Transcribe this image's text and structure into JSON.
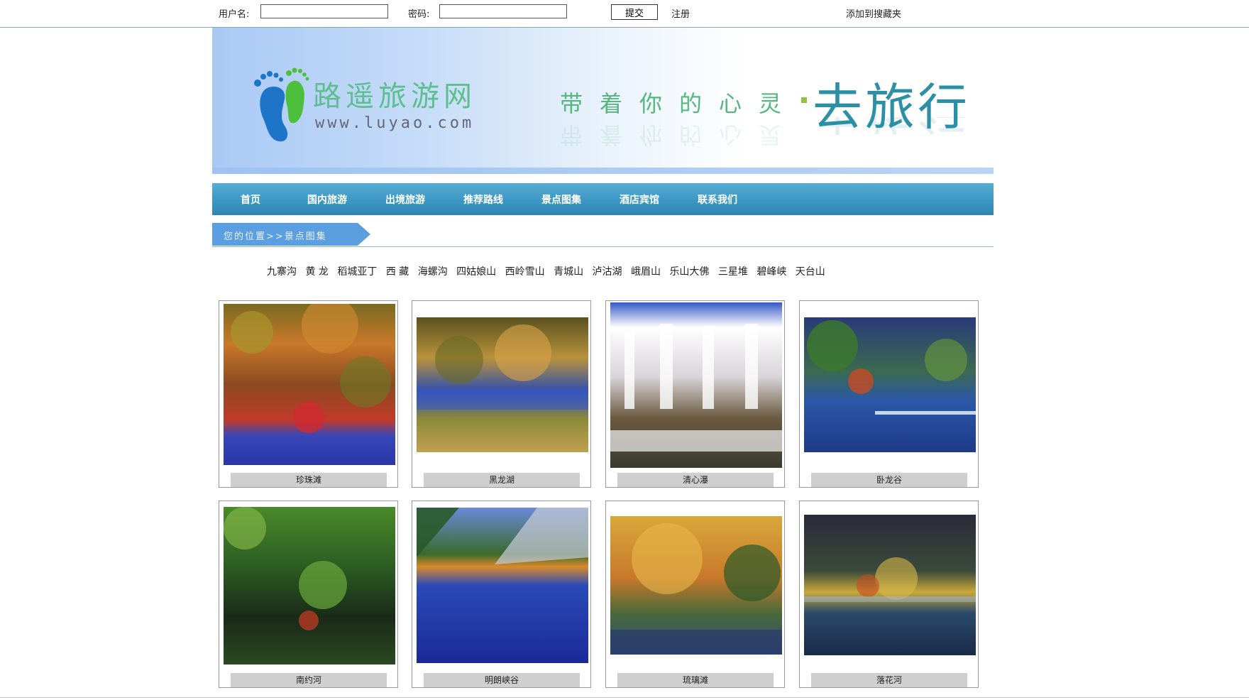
{
  "login": {
    "username_label": "用户名:",
    "password_label": "密码:",
    "submit_label": "提交",
    "register_label": "注册",
    "favorite_label": "添加到搜藏夹"
  },
  "banner": {
    "site_name": "路遥旅游网",
    "site_url": "www.luyao.com",
    "slogan_small": "带着你的心灵",
    "slogan_big": "去旅行"
  },
  "nav": [
    "首页",
    "国内旅游",
    "出境旅游",
    "推荐路线",
    "景点图集",
    "酒店宾馆",
    "联系我们"
  ],
  "breadcrumb": "您的位置>>景点图集",
  "spots": [
    "九寨沟",
    "黄 龙",
    "稻城亚丁",
    "西 藏",
    "海螺沟",
    "四姑娘山",
    "西岭雪山",
    "青城山",
    "泸沽湖",
    "峨眉山",
    "乐山大佛",
    "三星堆",
    "碧峰峡",
    "天台山"
  ],
  "gallery": [
    {
      "caption": "珍珠滩"
    },
    {
      "caption": "黑龙湖"
    },
    {
      "caption": "清心瀑"
    },
    {
      "caption": "卧龙谷"
    },
    {
      "caption": "南约河"
    },
    {
      "caption": "明朗峡谷"
    },
    {
      "caption": "琉璃滩"
    },
    {
      "caption": "落花河"
    }
  ],
  "colors": {
    "nav_bg": "#3d97c4",
    "logo_green": "#5dbe90",
    "slogan_blue": "#2b8fa6",
    "crumb_bg": "#5b9fe0"
  }
}
